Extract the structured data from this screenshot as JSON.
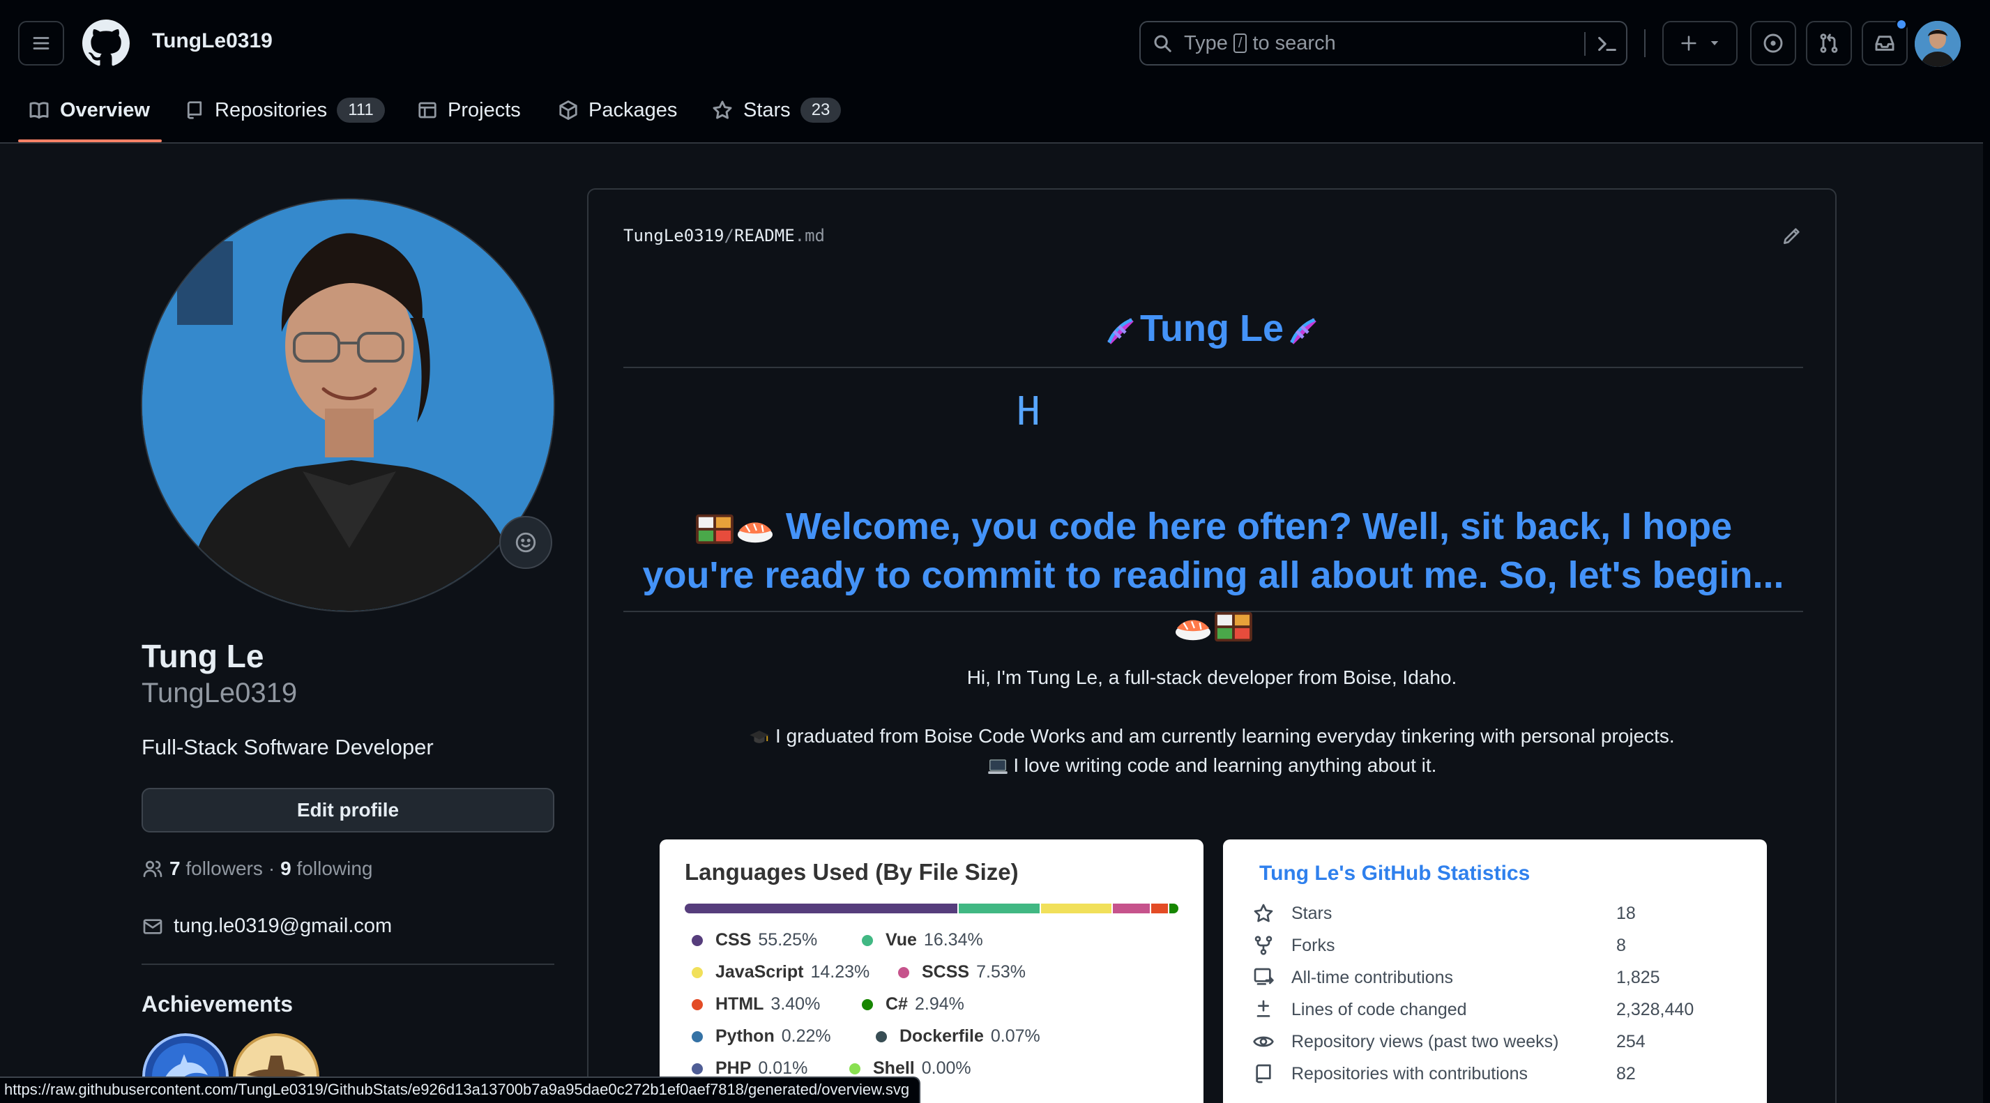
{
  "header": {
    "username": "TungLe0319",
    "search": {
      "prefix": "Type",
      "slash": "/",
      "suffix": "to search"
    }
  },
  "nav": {
    "tabs": [
      {
        "label": "Overview",
        "count": null
      },
      {
        "label": "Repositories",
        "count": "111"
      },
      {
        "label": "Projects",
        "count": null
      },
      {
        "label": "Packages",
        "count": null
      },
      {
        "label": "Stars",
        "count": "23"
      }
    ]
  },
  "sidebar": {
    "fullname": "Tung Le",
    "login": "TungLe0319",
    "bio": "Full-Stack Software Developer",
    "edit_label": "Edit profile",
    "followers_count": "7",
    "followers_label": "followers",
    "separator": "·",
    "following_count": "9",
    "following_label": "following",
    "email": "tung.le0319@gmail.com",
    "achievements_title": "Achievements"
  },
  "readme": {
    "path_user": "TungLe0319",
    "path_sep": "/",
    "path_file": "README",
    "path_ext": ".md",
    "title": "Tung Le",
    "typing_char": "H",
    "welcome": "Welcome, you code here often? Well, sit back, I hope you're ready to commit to reading all about me. So, let's begin...",
    "intro": "Hi, I'm Tung Le, a full-stack developer from Boise, Idaho.",
    "p1": "I graduated from Boise Code Works and am currently learning everyday tinkering with personal projects.",
    "p2": "I love writing code and learning anything about it."
  },
  "languages_card": {
    "title": "Languages Used (By File Size)",
    "items": [
      {
        "name": "CSS",
        "pct": "55.25%",
        "color": "#563d7c",
        "value": 55.25
      },
      {
        "name": "Vue",
        "pct": "16.34%",
        "color": "#41b883",
        "value": 16.34
      },
      {
        "name": "JavaScript",
        "pct": "14.23%",
        "color": "#f1e05a",
        "value": 14.23
      },
      {
        "name": "SCSS",
        "pct": "7.53%",
        "color": "#c6538c",
        "value": 7.53
      },
      {
        "name": "HTML",
        "pct": "3.40%",
        "color": "#e34c26",
        "value": 3.4
      },
      {
        "name": "C#",
        "pct": "2.94%",
        "color": "#178600",
        "value": 2.94
      },
      {
        "name": "Python",
        "pct": "0.22%",
        "color": "#3572a5",
        "value": 0.22
      },
      {
        "name": "Dockerfile",
        "pct": "0.07%",
        "color": "#384d54",
        "value": 0.07
      },
      {
        "name": "PHP",
        "pct": "0.01%",
        "color": "#4f5d95",
        "value": 0.01
      },
      {
        "name": "Shell",
        "pct": "0.00%",
        "color": "#89e051",
        "value": 0.0
      }
    ]
  },
  "stats_card": {
    "title": "Tung Le's GitHub Statistics",
    "rows": [
      {
        "icon": "star-icon",
        "label": "Stars",
        "value": "18"
      },
      {
        "icon": "fork-icon",
        "label": "Forks",
        "value": "8"
      },
      {
        "icon": "contributions-icon",
        "label": "All-time contributions",
        "value": "1,825"
      },
      {
        "icon": "diff-icon",
        "label": "Lines of code changed",
        "value": "2,328,440"
      },
      {
        "icon": "eye-icon",
        "label": "Repository views (past two weeks)",
        "value": "254"
      },
      {
        "icon": "repo-icon",
        "label": "Repositories with contributions",
        "value": "82"
      }
    ]
  },
  "status_url": "https://raw.githubusercontent.com/TungLe0319/GithubStats/e926d13a13700b7a9a95dae0c272b1ef0aef7818/generated/overview.svg",
  "colors": {
    "accent": "#4493f8",
    "tab_underline": "#f78166",
    "bg": "#0d1117"
  }
}
